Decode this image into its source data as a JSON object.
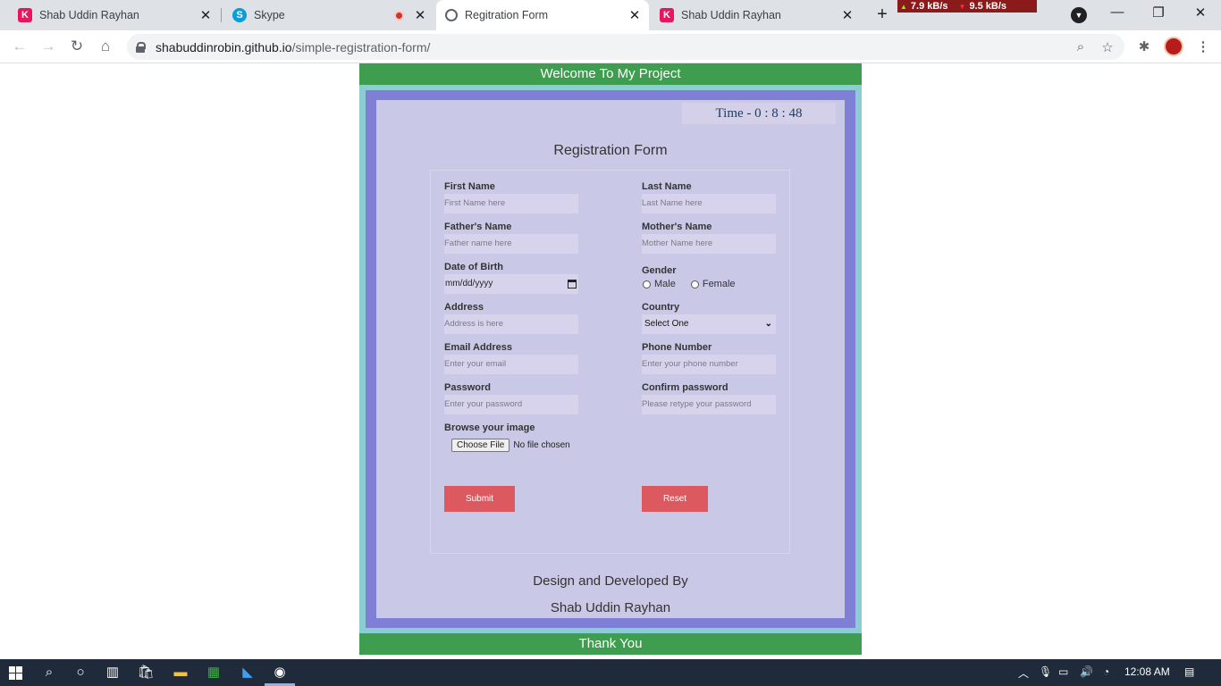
{
  "browser": {
    "tabs": [
      {
        "title": "Shab Uddin Rayhan",
        "favicon": "K"
      },
      {
        "title": "Skype",
        "favicon": "S"
      },
      {
        "title": "Regitration Form",
        "favicon": ""
      },
      {
        "title": "Shab Uddin Rayhan",
        "favicon": "K"
      }
    ],
    "net_up": "7.9 kB/s",
    "net_down": "9.5 kB/s",
    "url_host": "shabuddinrobin.github.io",
    "url_path": "/simple-registration-form/"
  },
  "page": {
    "welcome": "Welcome To My Project",
    "clock": "Time - 0 : 8 : 48",
    "form_title": "Registration Form",
    "fields": {
      "first_name": {
        "label": "First Name",
        "placeholder": "First Name here"
      },
      "last_name": {
        "label": "Last Name",
        "placeholder": "Last Name here"
      },
      "father_name": {
        "label": "Father's Name",
        "placeholder": "Father name here"
      },
      "mother_name": {
        "label": "Mother's Name",
        "placeholder": "Mother Name here"
      },
      "dob": {
        "label": "Date of Birth",
        "value": "mm/dd/yyyy"
      },
      "gender": {
        "label": "Gender",
        "options": [
          "Male",
          "Female"
        ]
      },
      "address": {
        "label": "Address",
        "placeholder": "Address is here"
      },
      "country": {
        "label": "Country",
        "selected": "Select One"
      },
      "email": {
        "label": "Email Address",
        "placeholder": "Enter your email"
      },
      "phone": {
        "label": "Phone Number",
        "placeholder": "Enter your phone number"
      },
      "password": {
        "label": "Password",
        "placeholder": "Enter your password"
      },
      "confirm": {
        "label": "Confirm password",
        "placeholder": "Please retype your password"
      },
      "image": {
        "label": "Browse your image",
        "button": "Choose File",
        "status": "No file chosen"
      }
    },
    "submit": "Submit",
    "reset": "Reset",
    "credit_line1": "Design and Developed By",
    "credit_line2": "Shab Uddin Rayhan",
    "thanks": "Thank You"
  },
  "taskbar": {
    "time": "12:08 AM"
  },
  "colors": {
    "header_green": "#3e9d4e",
    "frame_teal": "#8acdd2",
    "frame_purple": "#7f7fd6",
    "content_bg": "#c9c8e6",
    "button_red": "#dc5960"
  }
}
